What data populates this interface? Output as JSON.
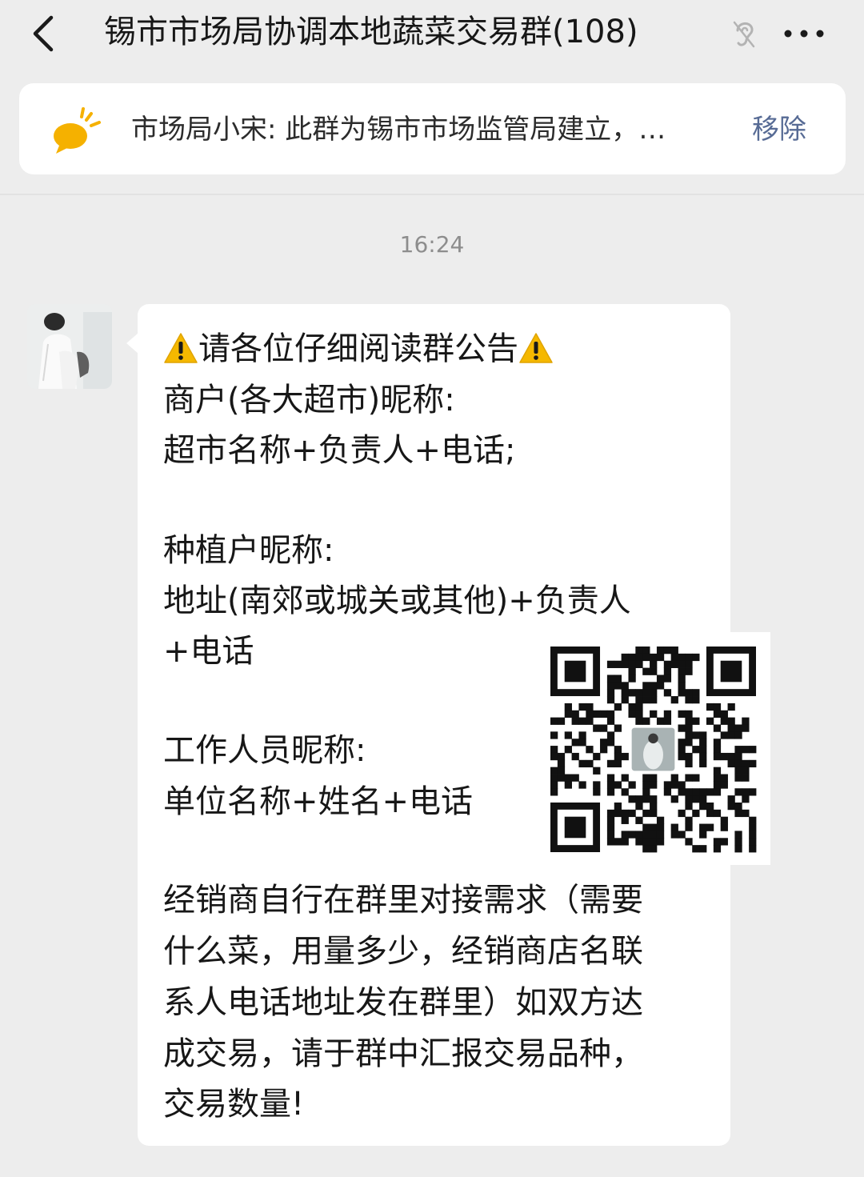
{
  "header": {
    "title": "锡市市场局协调本地蔬菜交易群(108)",
    "back_icon": "chevron-left-icon",
    "mute_icon": "ear-muted-icon",
    "more_icon": "ellipsis-icon"
  },
  "pinned": {
    "icon": "speech-bubble-icon",
    "text": "市场局小宋: 此群为锡市市场监管局建立，…",
    "action": "移除"
  },
  "timestamp": "16:24",
  "message": {
    "warning_icon": "warning-triangle-icon",
    "heading": "请各位仔细阅读群公告",
    "lines": [
      "商户(各大超市)昵称:",
      "超市名称+负责人+电话;",
      "种植户昵称:",
      "地址(南郊或城关或其他)+负责人",
      "+电话",
      "工作人员昵称:",
      "单位名称+姓名+电话",
      "经销商自行在群里对接需求（需要",
      "什么菜，用量多少，经销商店名联",
      "系人电话地址发在群里）如双方达",
      "成交易，请于群中汇报交易品种，",
      "交易数量!"
    ]
  },
  "colors": {
    "background": "#ededed",
    "bubble": "#ffffff",
    "link": "#576b95",
    "pin_icon": "#f5b100",
    "warning": "#f5b800"
  }
}
